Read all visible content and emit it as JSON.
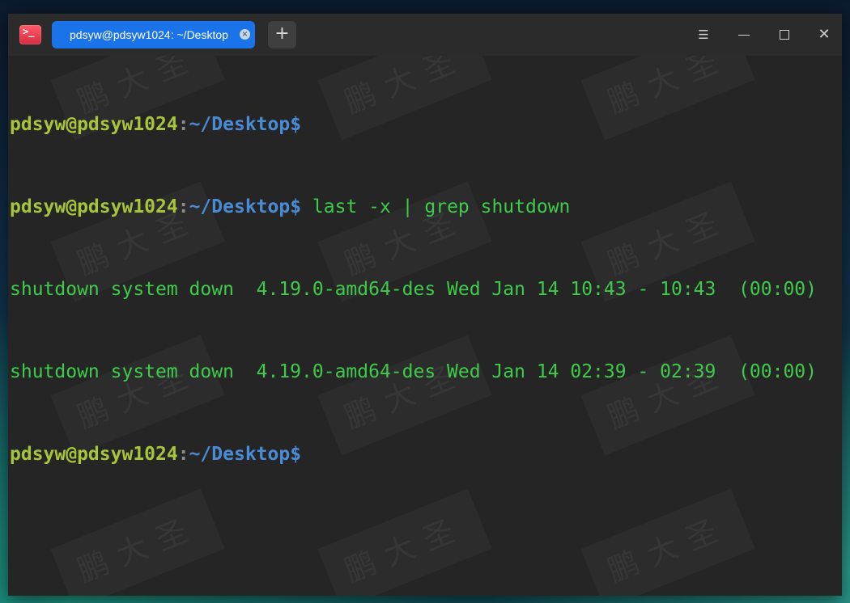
{
  "window": {
    "tab_title": "pdsyw@pdsyw1024: ~/Desktop",
    "tab_close_glyph": "×",
    "new_tab_glyph": "+",
    "menu_glyph": "☰",
    "close_glyph": "✕",
    "app_icon_glyph": ">_"
  },
  "terminal": {
    "prompt_user": "pdsyw@pdsyw1024",
    "prompt_sep": ":",
    "prompt_path": "~/Desktop",
    "prompt_dollar": "$",
    "command": " last -x | grep shutdown",
    "output": [
      "shutdown system down  4.19.0-amd64-des Wed Jan 14 10:43 - 10:43  (00:00)",
      "shutdown system down  4.19.0-amd64-des Wed Jan 14 02:39 - 02:39  (00:00)"
    ],
    "watermark_text": "鹏大圣"
  },
  "colors": {
    "tab_accent": "#1a73e8",
    "prompt_user": "#a7c43a",
    "prompt_path": "#4a8bd6",
    "output_text": "#3ecb4a",
    "terminal_bg": "#252525"
  }
}
